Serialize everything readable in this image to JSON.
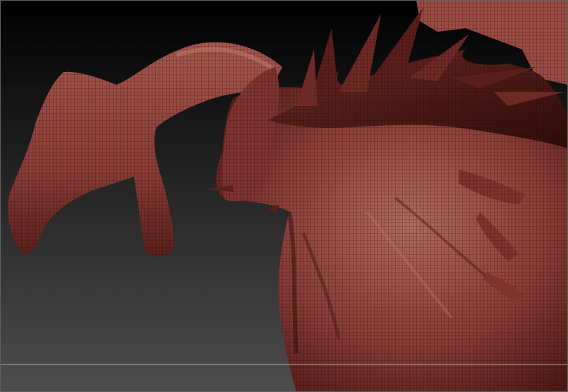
{
  "app": {
    "view": "3d-viewport",
    "display_mode": "polyframe-wireframe"
  },
  "scene": {
    "subject_icon": "dragon-sculpt-mesh",
    "mesh_color": "#8a3d36",
    "mesh_shadow_color": "#3a1210",
    "mesh_highlight_color": "#c07a6e",
    "wire_color": "#1c0605",
    "background_top": "#000000",
    "background_bottom": "#4d4d4d",
    "floor_grid_visible": true
  }
}
